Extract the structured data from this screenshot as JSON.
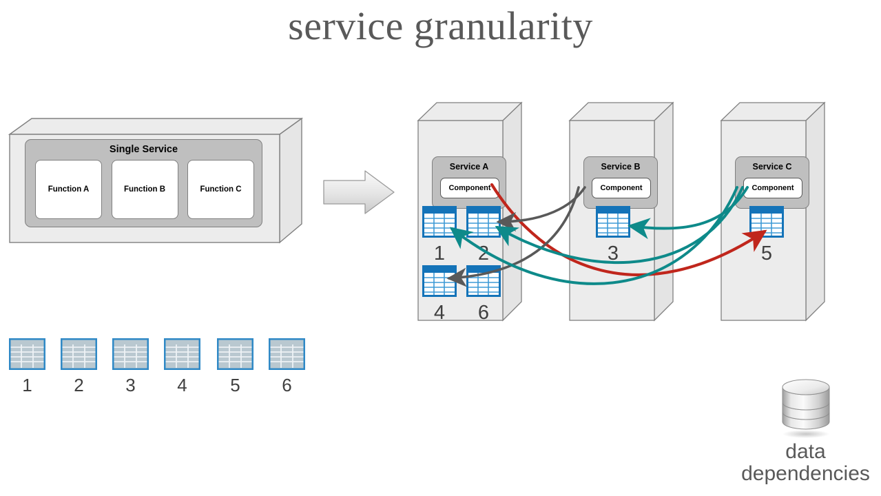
{
  "title": "service granularity",
  "monolith": {
    "label": "Single Service",
    "functions": [
      {
        "label": "Function A"
      },
      {
        "label": "Function B"
      },
      {
        "label": "Function C"
      }
    ]
  },
  "transform_arrow": {
    "icon": "block-arrow-right-icon"
  },
  "services": [
    {
      "name": "Service A",
      "component_label": "Component",
      "tables": [
        "1",
        "2",
        "4",
        "6"
      ]
    },
    {
      "name": "Service B",
      "component_label": "Component",
      "tables": [
        "3"
      ]
    },
    {
      "name": "Service C",
      "component_label": "Component",
      "tables": [
        "5"
      ]
    }
  ],
  "shared_tables": [
    "1",
    "2",
    "3",
    "4",
    "5",
    "6"
  ],
  "data_dependencies": {
    "icon": "database-cylinder-icon",
    "label_line1": "data",
    "label_line2": "dependencies"
  },
  "dependency_links": [
    {
      "from": "Service A",
      "to_table": "5",
      "color": "#C0261C"
    },
    {
      "from": "Service B",
      "to_table": "2",
      "color": "#595959"
    },
    {
      "from": "Service B",
      "to_table": "4",
      "color": "#595959"
    },
    {
      "from": "Service C",
      "to_table": "1",
      "color": "#0E8A8A"
    },
    {
      "from": "Service C",
      "to_table": "2",
      "color": "#0E8A8A"
    },
    {
      "from": "Service C",
      "to_table": "3",
      "color": "#0E8A8A"
    }
  ],
  "colors": {
    "title_gray": "#595959",
    "box_face": "#ececec",
    "box_panel": "#bfbfbf",
    "table_blue": "#1473B8",
    "table_pale": "#cfd8dd",
    "red": "#C0261C",
    "gray": "#595959",
    "teal": "#0E8A8A"
  }
}
